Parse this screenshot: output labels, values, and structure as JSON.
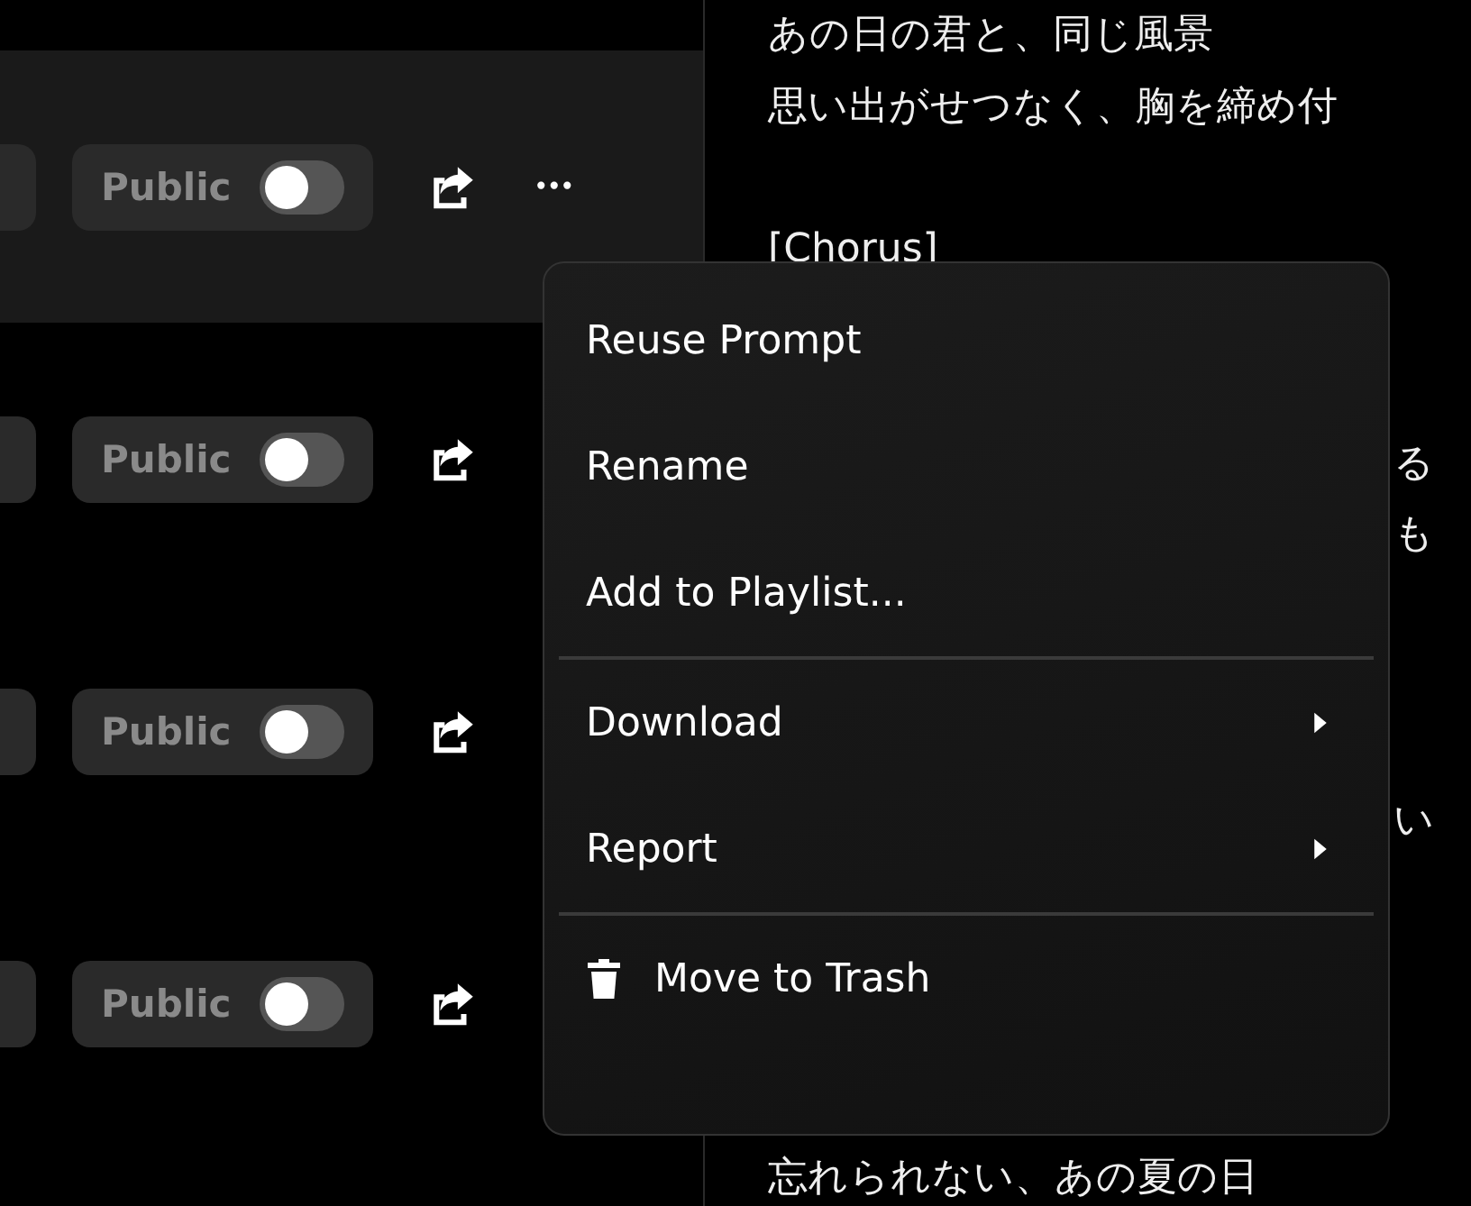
{
  "songs": [
    {
      "visibility_label": "Public",
      "public": false,
      "hovered": true
    },
    {
      "visibility_label": "Public",
      "public": false,
      "hovered": false
    },
    {
      "visibility_label": "Public",
      "public": false,
      "hovered": false
    },
    {
      "visibility_label": "Public",
      "public": false,
      "hovered": false
    }
  ],
  "more_button": "•••",
  "lyrics": [
    {
      "kind": "line",
      "text": "あの日の君と、同じ風景"
    },
    {
      "kind": "line",
      "text": "思い出がせつなく、胸を締め付"
    },
    {
      "kind": "gap"
    },
    {
      "kind": "line",
      "text": "[Chorus]"
    },
    {
      "kind": "gap"
    },
    {
      "kind": "gap"
    },
    {
      "kind": "fragment",
      "text": "る"
    },
    {
      "kind": "fragment",
      "text": "も"
    },
    {
      "kind": "gap"
    },
    {
      "kind": "gap"
    },
    {
      "kind": "gap"
    },
    {
      "kind": "fragment",
      "text": "い"
    },
    {
      "kind": "gap"
    },
    {
      "kind": "gap"
    },
    {
      "kind": "gap"
    },
    {
      "kind": "gap"
    },
    {
      "kind": "line",
      "text": "忘れられない、あの夏の日"
    }
  ],
  "context_menu": {
    "items": [
      {
        "kind": "item",
        "label": "Reuse Prompt"
      },
      {
        "kind": "item",
        "label": "Rename"
      },
      {
        "kind": "item",
        "label": "Add to Playlist..."
      },
      {
        "kind": "divider"
      },
      {
        "kind": "submenu",
        "label": "Download"
      },
      {
        "kind": "submenu",
        "label": "Report"
      },
      {
        "kind": "divider"
      },
      {
        "kind": "trash",
        "label": "Move to Trash"
      }
    ]
  }
}
